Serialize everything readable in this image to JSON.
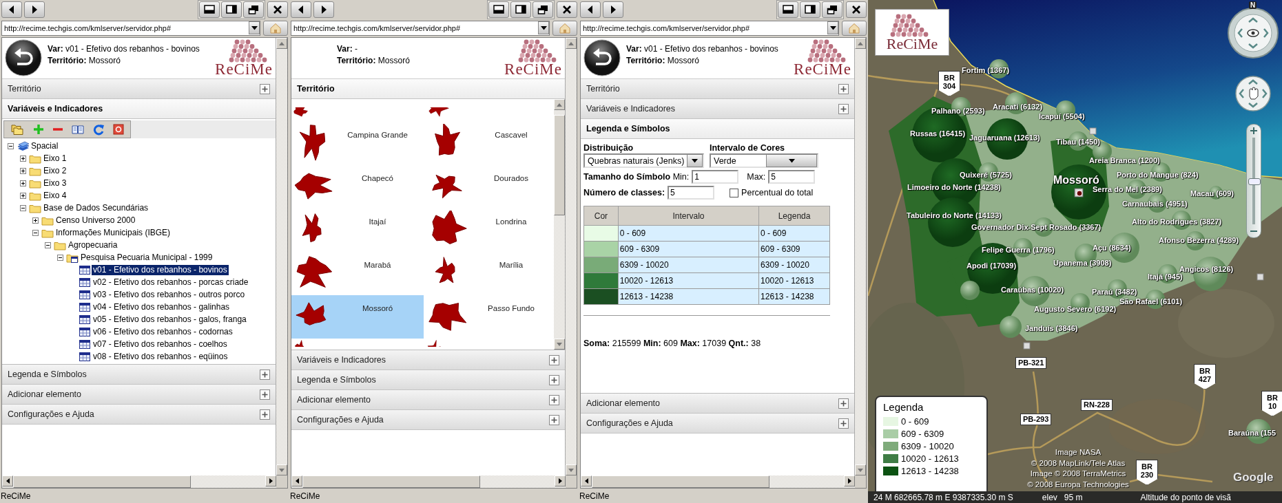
{
  "panels": [
    {
      "url": "http://recime.techgis.com/kmlserver/servidor.php#",
      "header": {
        "back_button": true,
        "var_text": "**Var:** v01 - Efetivo dos rebanhos - bovinos",
        "territory_text": "**Território:** Mossoró",
        "logo": "ReCiMe"
      },
      "sections": [
        {
          "title": "Território",
          "expanded": false
        },
        {
          "title": "Variáveis e Indicadores",
          "expanded": true,
          "content": {
            "kind": "tree",
            "nodes": [
              {
                "label": "Spacial",
                "kind": "root",
                "expanded": true,
                "selected": false,
                "children": [
                  {
                    "label": "Eixo 1",
                    "kind": "folder",
                    "expanded": false,
                    "selected": false
                  },
                  {
                    "label": "Eixo 2",
                    "kind": "folder",
                    "expanded": false,
                    "selected": false
                  },
                  {
                    "label": "Eixo 3",
                    "kind": "folder",
                    "expanded": false,
                    "selected": false
                  },
                  {
                    "label": "Eixo 4",
                    "kind": "folder",
                    "expanded": false,
                    "selected": false
                  },
                  {
                    "label": "Base de Dados Secundárias",
                    "kind": "folder",
                    "expanded": true,
                    "selected": false,
                    "children": [
                      {
                        "label": "Censo Universo 2000",
                        "kind": "folder",
                        "expanded": false,
                        "selected": false
                      },
                      {
                        "label": "Informações Municipais (IBGE)",
                        "kind": "folder",
                        "expanded": true,
                        "selected": false,
                        "children": [
                          {
                            "label": "Agropecuaria",
                            "kind": "folder",
                            "expanded": true,
                            "selected": false,
                            "children": [
                              {
                                "label": "Pesquisa Pecuaria Municipal - 1999",
                                "kind": "table_folder",
                                "expanded": true,
                                "selected": false,
                                "children": [
                                  {
                                    "label": "v01 - Efetivo dos rebanhos - bovinos",
                                    "kind": "variable",
                                    "selected": true
                                  },
                                  {
                                    "label": "v02 - Efetivo dos rebanhos - porcas criade",
                                    "kind": "variable",
                                    "selected": false
                                  },
                                  {
                                    "label": "v03 - Efetivo dos rebanhos - outros porco",
                                    "kind": "variable",
                                    "selected": false
                                  },
                                  {
                                    "label": "v04 - Efetivo dos rebanhos - galinhas",
                                    "kind": "variable",
                                    "selected": false
                                  },
                                  {
                                    "label": "v05 - Efetivo dos rebanhos - galos, franga",
                                    "kind": "variable",
                                    "selected": false
                                  },
                                  {
                                    "label": "v06 - Efetivo dos rebanhos - codornas",
                                    "kind": "variable",
                                    "selected": false
                                  },
                                  {
                                    "label": "v07 - Efetivo dos rebanhos - coelhos",
                                    "kind": "variable",
                                    "selected": false
                                  },
                                  {
                                    "label": "v08 - Efetivo dos rebanhos - eqüinos",
                                    "kind": "variable",
                                    "selected": false
                                  }
                                ]
                              }
                            ]
                          }
                        ]
                      }
                    ]
                  }
                ]
              }
            ]
          }
        },
        {
          "title": "Legenda e Símbolos",
          "expanded": false
        },
        {
          "title": "Adicionar elemento",
          "expanded": false
        },
        {
          "title": "Configurações e Ajuda",
          "expanded": false
        }
      ],
      "status": "ReCiMe"
    },
    {
      "url": "http://recime.techgis.com/kmlserver/servidor.php#",
      "header": {
        "back_button": false,
        "var_text": "**Var:** -",
        "territory_text": "**Território:** Mossoró",
        "logo": "ReCiMe"
      },
      "sections": [
        {
          "title": "Território",
          "expanded": true,
          "content": {
            "kind": "territory_grid",
            "cells": [
              {
                "selected": false
              },
              {
                "selected": false
              },
              {
                "name": "Campina Grande",
                "selected": false
              },
              {
                "name": "Cascavel",
                "selected": false
              },
              {
                "name": "Chapecó",
                "selected": false
              },
              {
                "name": "Dourados",
                "selected": false
              },
              {
                "name": "Itajaí",
                "selected": false
              },
              {
                "name": "Londrina",
                "selected": false
              },
              {
                "name": "Marabá",
                "selected": false
              },
              {
                "name": "Marília",
                "selected": false
              },
              {
                "name": "Mossoró",
                "selected": true
              },
              {
                "name": "Passo Fundo",
                "selected": false
              },
              {
                "selected": false
              },
              {
                "selected": false
              }
            ]
          }
        },
        {
          "title": "Variáveis e Indicadores",
          "expanded": false
        },
        {
          "title": "Legenda e Símbolos",
          "expanded": false
        },
        {
          "title": "Adicionar elemento",
          "expanded": false
        },
        {
          "title": "Configurações e Ajuda",
          "expanded": false
        }
      ],
      "status": "ReCiMe"
    },
    {
      "url": "http://recime.techgis.com/kmlserver/servidor.php#",
      "header": {
        "back_button": true,
        "var_text": "**Var:** v01 - Efetivo dos rebanhos - bovinos",
        "territory_text": "**Território:** Mossoró",
        "logo": "ReCiMe"
      },
      "sections": [
        {
          "title": "Território",
          "expanded": false
        },
        {
          "title": "Variáveis e Indicadores",
          "expanded": false
        },
        {
          "title": "Legenda e Símbolos",
          "expanded": true,
          "content": {
            "kind": "legend_form",
            "distribution": {
              "label": "Distribuição",
              "value": "Quebras naturais (Jenks)"
            },
            "color_range": {
              "label": "Intervalo de Cores",
              "value": "Verde"
            },
            "symbol_size": {
              "label": "**Tamanho do Símbolo** Min:",
              "min": "1",
              "max_label": "Max:",
              "max": "5"
            },
            "classes": {
              "label": "Número de classes:",
              "value": "5"
            },
            "percent": {
              "label": "Percentual do total",
              "checked": false
            },
            "table": {
              "columns": [
                "Cor",
                "Intervalo",
                "Legenda"
              ],
              "rows": [
                {
                  "color": "#e8fbe6",
                  "interval": "0 - 609",
                  "legend": "0 - 609"
                },
                {
                  "color": "#a9d3a6",
                  "interval": "609 - 6309",
                  "legend": "609 - 6309"
                },
                {
                  "color": "#79ab78",
                  "interval": "6309 - 10020",
                  "legend": "6309 - 10020"
                },
                {
                  "color": "#2f7a3a",
                  "interval": "10020 - 12613",
                  "legend": "10020 - 12613"
                },
                {
                  "color": "#1b4f22",
                  "interval": "12613 - 14238",
                  "legend": "12613 - 14238"
                }
              ]
            },
            "summary": "**Soma:** 215599 **Min:** 609 **Max:** 17039 **Qnt.:** 38"
          }
        },
        {
          "title": "Adicionar elemento",
          "expanded": false
        },
        {
          "title": "Configurações e Ajuda",
          "expanded": false
        }
      ],
      "status": "ReCiMe"
    }
  ],
  "map": {
    "logo": "ReCiMe",
    "compass_north": "N",
    "zoom_slider": {
      "level": 0.5
    },
    "labels": [
      {
        "text": "Fortim (1367)",
        "kind": "city"
      },
      {
        "text": "Palhano (2593)",
        "kind": "city"
      },
      {
        "text": "Aracati (6132)",
        "kind": "city"
      },
      {
        "text": "Icapuí (5504)",
        "kind": "city"
      },
      {
        "text": "Russas (16415)",
        "kind": "city"
      },
      {
        "text": "Jaguaruana (12613)",
        "kind": "city"
      },
      {
        "text": "Tibau (1450)",
        "kind": "city"
      },
      {
        "text": "Areia Branca (1200)",
        "kind": "city"
      },
      {
        "text": "Quixeré (5725)",
        "kind": "city"
      },
      {
        "text": "Mossoró",
        "kind": "capital"
      },
      {
        "text": "Porto do Mangue (824)",
        "kind": "city"
      },
      {
        "text": "Limoeiro do Norte (14238)",
        "kind": "city"
      },
      {
        "text": "Serra do Mel (2389)",
        "kind": "city"
      },
      {
        "text": "Macau (609)",
        "kind": "city"
      },
      {
        "text": "Carnaubais (4951)",
        "kind": "city"
      },
      {
        "text": "Tabuleiro do Norte (14133)",
        "kind": "city"
      },
      {
        "text": "Alto do Rodrigues (3827)",
        "kind": "city"
      },
      {
        "text": "Governador Dix-Sept Rosado (3367)",
        "kind": "city"
      },
      {
        "text": "Afonso Bezerra (4289)",
        "kind": "city"
      },
      {
        "text": "Açu (8634)",
        "kind": "city"
      },
      {
        "text": "Felipe Guerra (1796)",
        "kind": "city"
      },
      {
        "text": "Upanema (3908)",
        "kind": "city"
      },
      {
        "text": "Apodi (17039)",
        "kind": "city"
      },
      {
        "text": "Angicos (8126)",
        "kind": "city"
      },
      {
        "text": "Itajá (945)",
        "kind": "city"
      },
      {
        "text": "Caraúbas (10020)",
        "kind": "city"
      },
      {
        "text": "Paraú (3482)",
        "kind": "city"
      },
      {
        "text": "São Rafael (6101)",
        "kind": "city"
      },
      {
        "text": "Augusto Severo (6192)",
        "kind": "city"
      },
      {
        "text": "Janduís (3846)",
        "kind": "city"
      },
      {
        "text": "Baraúna (155",
        "kind": "city"
      }
    ],
    "road_signs": [
      {
        "kind": "federal",
        "prefix": "BR",
        "number": "304"
      },
      {
        "kind": "state",
        "text": "PB-321"
      },
      {
        "kind": "state",
        "text": "RN-228"
      },
      {
        "kind": "state",
        "text": "PB-293"
      },
      {
        "kind": "federal",
        "prefix": "BR",
        "number": "427"
      },
      {
        "kind": "federal",
        "prefix": "BR",
        "number": "230"
      },
      {
        "kind": "federal",
        "prefix": "BR",
        "number": "10"
      }
    ],
    "legend": {
      "title": "Legenda",
      "items": [
        {
          "color": "#e6f6e2",
          "label": "0 - 609"
        },
        {
          "color": "#a9cda6",
          "label": "609 - 6309"
        },
        {
          "color": "#7fab7b",
          "label": "6309 - 10020"
        },
        {
          "color": "#3f7d45",
          "label": "10020 - 12613"
        },
        {
          "color": "#0c5212",
          "label": "12613 - 14238"
        }
      ]
    },
    "credits": [
      "Image NASA",
      "© 2008 MapLink/Tele Atlas",
      "Image © 2008 TerraMetrics",
      "© 2008 Europa Technologies"
    ],
    "provider": "Google",
    "status": {
      "coordinates": "24 M 682665.78 m E 9387335.30 m S",
      "elevation": "elev   95 m",
      "eye_altitude": "Altitude do ponto de visã"
    }
  }
}
